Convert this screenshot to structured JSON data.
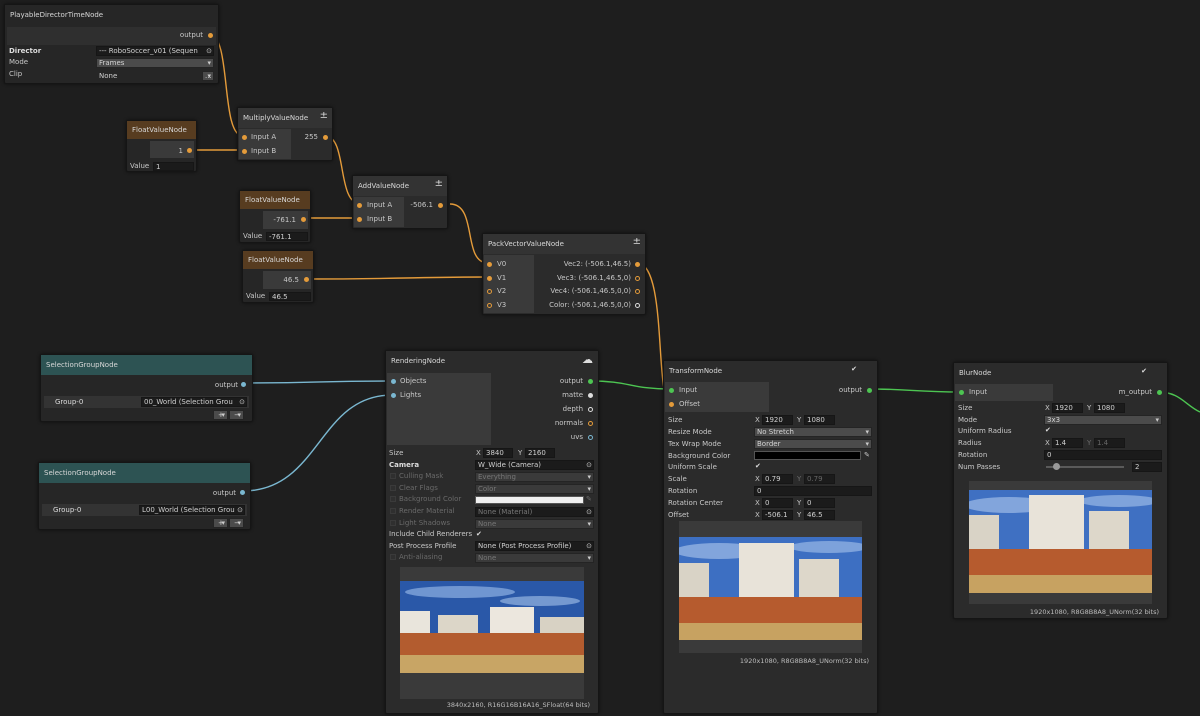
{
  "playable": {
    "title": "PlayableDirectorTimeNode",
    "output": "output",
    "director_label": "Director",
    "director_value": "--- RoboSoccer_v01 (Sequen",
    "mode_label": "Mode",
    "mode_value": "Frames",
    "clip_label": "Clip",
    "clip_value": "None",
    "clip_btn": "..."
  },
  "float1": {
    "title": "FloatValueNode",
    "out": "1",
    "value_label": "Value",
    "value": "1"
  },
  "float2": {
    "title": "FloatValueNode",
    "out": "-761.1",
    "value_label": "Value",
    "value": "-761.1"
  },
  "float3": {
    "title": "FloatValueNode",
    "out": "46.5",
    "value_label": "Value",
    "value": "46.5"
  },
  "multiply": {
    "title": "MultiplyValueNode",
    "in_a": "Input A",
    "in_b": "Input B",
    "out": "255",
    "icon": "±"
  },
  "add": {
    "title": "AddValueNode",
    "in_a": "Input A",
    "in_b": "Input B",
    "out": "-506.1",
    "icon": "±"
  },
  "pack": {
    "title": "PackVectorValueNode",
    "icon": "±",
    "inputs": [
      "V0",
      "V1",
      "V2",
      "V3"
    ],
    "outputs": [
      "Vec2: (-506.1,46.5)",
      "Vec3: (-506.1,46.5,0)",
      "Vec4: (-506.1,46.5,0,0)",
      "Color: (-506.1,46.5,0,0)"
    ]
  },
  "sel1": {
    "title": "SelectionGroupNode",
    "output": "output",
    "group_label": "Group-0",
    "group_value": "00_World (Selection Grou",
    "plus": "+",
    "minus": "−"
  },
  "sel2": {
    "title": "SelectionGroupNode",
    "output": "output",
    "group_label": "Group-0",
    "group_value": "L00_World (Selection Grou",
    "plus": "+",
    "minus": "−"
  },
  "render": {
    "title": "RenderingNode",
    "in_objects": "Objects",
    "in_lights": "Lights",
    "outputs": [
      "output",
      "matte",
      "depth",
      "normals",
      "uvs"
    ],
    "size_label": "Size",
    "x_label": "X",
    "size_x": "3840",
    "y_label": "Y",
    "size_y": "2160",
    "camera_label": "Camera",
    "camera_value": "W_Wide (Camera)",
    "culling_label": "Culling Mask",
    "culling_value": "Everything",
    "clear_label": "Clear Flags",
    "clear_value": "Color",
    "bg_label": "Background Color",
    "mat_label": "Render Material",
    "mat_value": "None (Material)",
    "light_label": "Light Shadows",
    "light_value": "None",
    "child_label": "Include Child Renderers",
    "ppp_label": "Post Process Profile",
    "ppp_value": "None (Post Process Profile)",
    "aa_label": "Anti-aliasing",
    "aa_value": "None",
    "caption": "3840x2160, R16G16B16A16_SFloat(64 bits)"
  },
  "transform": {
    "title": "TransformNode",
    "in_input": "Input",
    "in_offset": "Offset",
    "output": "output",
    "size_label": "Size",
    "x_label": "X",
    "size_x": "1920",
    "y_label": "Y",
    "size_y": "1080",
    "resize_label": "Resize Mode",
    "resize_value": "No Stretch",
    "wrap_label": "Tex Wrap Mode",
    "wrap_value": "Border",
    "bg_label": "Background Color",
    "uniform_label": "Uniform Scale",
    "scale_label": "Scale",
    "scale_x": "0.79",
    "scale_y": "0.79",
    "rot_label": "Rotation",
    "rot_value": "0",
    "rc_label": "Rotation Center",
    "rc_x": "0",
    "rc_y": "0",
    "off_label": "Offset",
    "off_x": "-506.1",
    "off_y": "46.5",
    "caption": "1920x1080, R8G8B8A8_UNorm(32 bits)"
  },
  "blur": {
    "title": "BlurNode",
    "in_input": "Input",
    "out": "m_output",
    "size_label": "Size",
    "x_label": "X",
    "size_x": "1920",
    "y_label": "Y",
    "size_y": "1080",
    "mode_label": "Mode",
    "mode_value": "3x3",
    "uradius_label": "Uniform Radius",
    "radius_label": "Radius",
    "radius_x": "1.4",
    "radius_y": "1.4",
    "rot_label": "Rotation",
    "rot_value": "0",
    "passes_label": "Num Passes",
    "passes_value": "2",
    "caption": "1920x1080, R8G8B8A8_UNorm(32 bits)"
  },
  "colors": {
    "orange": "#e49b3a",
    "blue": "#7ab7d0",
    "green": "#4dc552"
  }
}
